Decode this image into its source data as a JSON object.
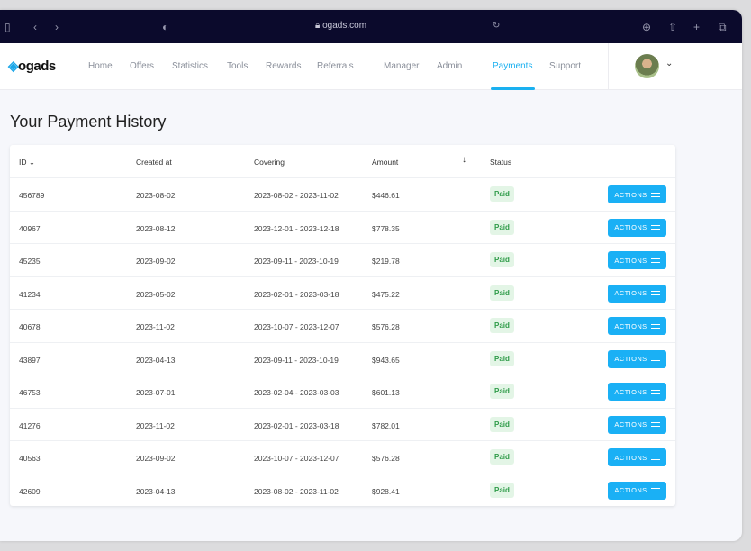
{
  "browser": {
    "url": "ogads.com"
  },
  "nav": {
    "logo": "ogads",
    "items": [
      "Home",
      "Offers",
      "Statistics",
      "Tools",
      "Rewards",
      "Referrals",
      "Manager",
      "Admin",
      "Payments",
      "Support"
    ],
    "active": "Payments"
  },
  "page": {
    "title": "Your Payment  History"
  },
  "table": {
    "headers": [
      "ID",
      "Created at",
      "Covering",
      "Amount",
      "Status"
    ],
    "action_label": "ACTIONS",
    "rows": [
      {
        "id": "456789",
        "created": "2023-08-02",
        "covering": "2023-08-02 - 2023-11-02",
        "amount": "$446.61",
        "status": "Paid"
      },
      {
        "id": "40967",
        "created": "2023-08-12",
        "covering": "2023-12-01 - 2023-12-18",
        "amount": "$778.35",
        "status": "Paid"
      },
      {
        "id": "45235",
        "created": "2023-09-02",
        "covering": "2023-09-11 - 2023-10-19",
        "amount": "$219.78",
        "status": "Paid"
      },
      {
        "id": "41234",
        "created": "2023-05-02",
        "covering": "2023-02-01 - 2023-03-18",
        "amount": "$475.22",
        "status": "Paid"
      },
      {
        "id": "40678",
        "created": "2023-11-02",
        "covering": "2023-10-07 - 2023-12-07",
        "amount": "$576.28",
        "status": "Paid"
      },
      {
        "id": "43897",
        "created": "2023-04-13",
        "covering": "2023-09-11 - 2023-10-19",
        "amount": "$943.65",
        "status": "Paid"
      },
      {
        "id": "46753",
        "created": "2023-07-01",
        "covering": "2023-02-04 - 2023-03-03",
        "amount": "$601.13",
        "status": "Paid"
      },
      {
        "id": "41276",
        "created": "2023-11-02",
        "covering": "2023-02-01 - 2023-03-18",
        "amount": "$782.01",
        "status": "Paid"
      },
      {
        "id": "40563",
        "created": "2023-09-02",
        "covering": "2023-10-07 - 2023-12-07",
        "amount": "$576.28",
        "status": "Paid"
      },
      {
        "id": "42609",
        "created": "2023-04-13",
        "covering": "2023-08-02 - 2023-11-02",
        "amount": "$928.41",
        "status": "Paid"
      }
    ]
  },
  "colors": {
    "accent": "#1ab0f5",
    "paid_bg": "#e3f5e6",
    "paid_text": "#2e9b48",
    "topbar": "#0b0a2c"
  }
}
